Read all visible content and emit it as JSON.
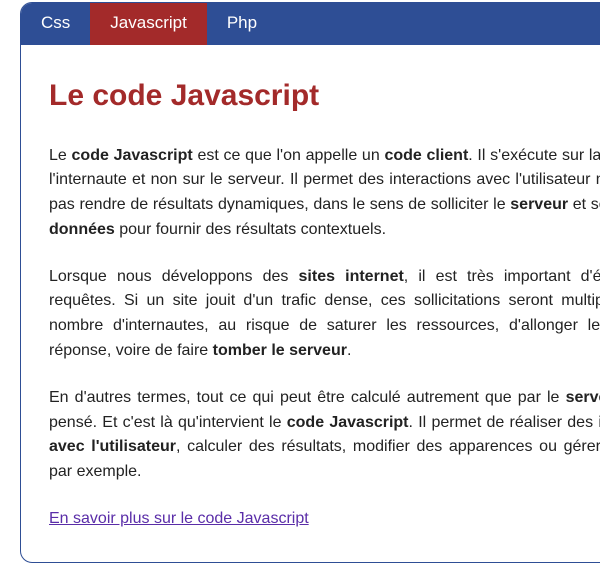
{
  "tabs": {
    "css": "Css",
    "js": "Javascript",
    "php": "Php"
  },
  "active_tab": "Javascript",
  "title": "Le code Javascript",
  "p1": {
    "t1": "Le ",
    "b1": "code Javascript",
    "t2": " est ce que l'on appelle un ",
    "b2": "code client",
    "t3": ". Il s'exécute sur la machine de l'internaute et non sur le serveur. Il permet des interactions avec l'utilisateur mais ne peut pas rendre de résultats dynamiques, dans le sens de solliciter le ",
    "b3": "serveur",
    "t4": " et ses ",
    "b4": "bases de données",
    "t5": " pour fournir des résultats contextuels."
  },
  "p2": {
    "t1": "Lorsque nous développons des ",
    "b1": "sites internet",
    "t2": ", il est très important d'équilibrer les requêtes. Si un site jouit d'un trafic dense, ces sollicitations seront multipliées par le nombre d'internautes, au risque de saturer les ressources, d'allonger les temps de réponse, voire de faire ",
    "b2": "tomber le serveur",
    "t3": "."
  },
  "p3": {
    "t1": "En d'autres termes, tout ce qui peut être calculé autrement que par le ",
    "b1": "serveur",
    "t2": " doit être pensé. Et c'est là qu'intervient le ",
    "b2": "code Javascript",
    "t3": ". Il permet de réaliser des ",
    "b3": "interactions avec l'utilisateur",
    "t4": ", calculer des résultats, modifier des apparences ou gérer les cookies par exemple."
  },
  "link": "En savoir plus sur le code Javascript"
}
